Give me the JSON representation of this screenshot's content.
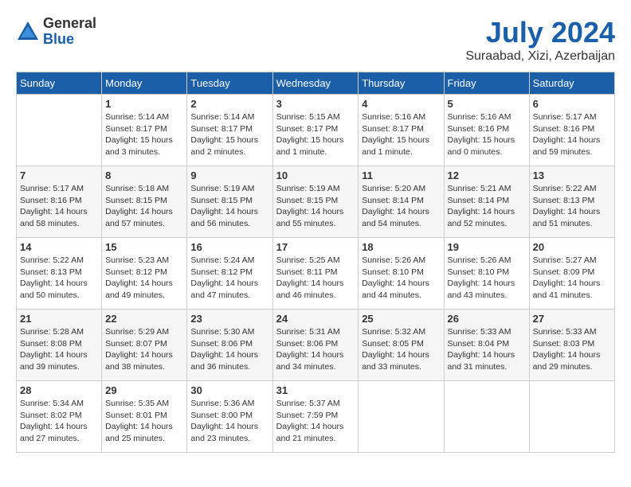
{
  "header": {
    "logo_general": "General",
    "logo_blue": "Blue",
    "month_title": "July 2024",
    "subtitle": "Suraabad, Xizi, Azerbaijan"
  },
  "calendar": {
    "headers": [
      "Sunday",
      "Monday",
      "Tuesday",
      "Wednesday",
      "Thursday",
      "Friday",
      "Saturday"
    ],
    "rows": [
      [
        {
          "day": "",
          "info": ""
        },
        {
          "day": "1",
          "info": "Sunrise: 5:14 AM\nSunset: 8:17 PM\nDaylight: 15 hours\nand 3 minutes."
        },
        {
          "day": "2",
          "info": "Sunrise: 5:14 AM\nSunset: 8:17 PM\nDaylight: 15 hours\nand 2 minutes."
        },
        {
          "day": "3",
          "info": "Sunrise: 5:15 AM\nSunset: 8:17 PM\nDaylight: 15 hours\nand 1 minute."
        },
        {
          "day": "4",
          "info": "Sunrise: 5:16 AM\nSunset: 8:17 PM\nDaylight: 15 hours\nand 1 minute."
        },
        {
          "day": "5",
          "info": "Sunrise: 5:16 AM\nSunset: 8:16 PM\nDaylight: 15 hours\nand 0 minutes."
        },
        {
          "day": "6",
          "info": "Sunrise: 5:17 AM\nSunset: 8:16 PM\nDaylight: 14 hours\nand 59 minutes."
        }
      ],
      [
        {
          "day": "7",
          "info": "Sunrise: 5:17 AM\nSunset: 8:16 PM\nDaylight: 14 hours\nand 58 minutes."
        },
        {
          "day": "8",
          "info": "Sunrise: 5:18 AM\nSunset: 8:15 PM\nDaylight: 14 hours\nand 57 minutes."
        },
        {
          "day": "9",
          "info": "Sunrise: 5:19 AM\nSunset: 8:15 PM\nDaylight: 14 hours\nand 56 minutes."
        },
        {
          "day": "10",
          "info": "Sunrise: 5:19 AM\nSunset: 8:15 PM\nDaylight: 14 hours\nand 55 minutes."
        },
        {
          "day": "11",
          "info": "Sunrise: 5:20 AM\nSunset: 8:14 PM\nDaylight: 14 hours\nand 54 minutes."
        },
        {
          "day": "12",
          "info": "Sunrise: 5:21 AM\nSunset: 8:14 PM\nDaylight: 14 hours\nand 52 minutes."
        },
        {
          "day": "13",
          "info": "Sunrise: 5:22 AM\nSunset: 8:13 PM\nDaylight: 14 hours\nand 51 minutes."
        }
      ],
      [
        {
          "day": "14",
          "info": "Sunrise: 5:22 AM\nSunset: 8:13 PM\nDaylight: 14 hours\nand 50 minutes."
        },
        {
          "day": "15",
          "info": "Sunrise: 5:23 AM\nSunset: 8:12 PM\nDaylight: 14 hours\nand 49 minutes."
        },
        {
          "day": "16",
          "info": "Sunrise: 5:24 AM\nSunset: 8:12 PM\nDaylight: 14 hours\nand 47 minutes."
        },
        {
          "day": "17",
          "info": "Sunrise: 5:25 AM\nSunset: 8:11 PM\nDaylight: 14 hours\nand 46 minutes."
        },
        {
          "day": "18",
          "info": "Sunrise: 5:26 AM\nSunset: 8:10 PM\nDaylight: 14 hours\nand 44 minutes."
        },
        {
          "day": "19",
          "info": "Sunrise: 5:26 AM\nSunset: 8:10 PM\nDaylight: 14 hours\nand 43 minutes."
        },
        {
          "day": "20",
          "info": "Sunrise: 5:27 AM\nSunset: 8:09 PM\nDaylight: 14 hours\nand 41 minutes."
        }
      ],
      [
        {
          "day": "21",
          "info": "Sunrise: 5:28 AM\nSunset: 8:08 PM\nDaylight: 14 hours\nand 39 minutes."
        },
        {
          "day": "22",
          "info": "Sunrise: 5:29 AM\nSunset: 8:07 PM\nDaylight: 14 hours\nand 38 minutes."
        },
        {
          "day": "23",
          "info": "Sunrise: 5:30 AM\nSunset: 8:06 PM\nDaylight: 14 hours\nand 36 minutes."
        },
        {
          "day": "24",
          "info": "Sunrise: 5:31 AM\nSunset: 8:06 PM\nDaylight: 14 hours\nand 34 minutes."
        },
        {
          "day": "25",
          "info": "Sunrise: 5:32 AM\nSunset: 8:05 PM\nDaylight: 14 hours\nand 33 minutes."
        },
        {
          "day": "26",
          "info": "Sunrise: 5:33 AM\nSunset: 8:04 PM\nDaylight: 14 hours\nand 31 minutes."
        },
        {
          "day": "27",
          "info": "Sunrise: 5:33 AM\nSunset: 8:03 PM\nDaylight: 14 hours\nand 29 minutes."
        }
      ],
      [
        {
          "day": "28",
          "info": "Sunrise: 5:34 AM\nSunset: 8:02 PM\nDaylight: 14 hours\nand 27 minutes."
        },
        {
          "day": "29",
          "info": "Sunrise: 5:35 AM\nSunset: 8:01 PM\nDaylight: 14 hours\nand 25 minutes."
        },
        {
          "day": "30",
          "info": "Sunrise: 5:36 AM\nSunset: 8:00 PM\nDaylight: 14 hours\nand 23 minutes."
        },
        {
          "day": "31",
          "info": "Sunrise: 5:37 AM\nSunset: 7:59 PM\nDaylight: 14 hours\nand 21 minutes."
        },
        {
          "day": "",
          "info": ""
        },
        {
          "day": "",
          "info": ""
        },
        {
          "day": "",
          "info": ""
        }
      ]
    ]
  }
}
